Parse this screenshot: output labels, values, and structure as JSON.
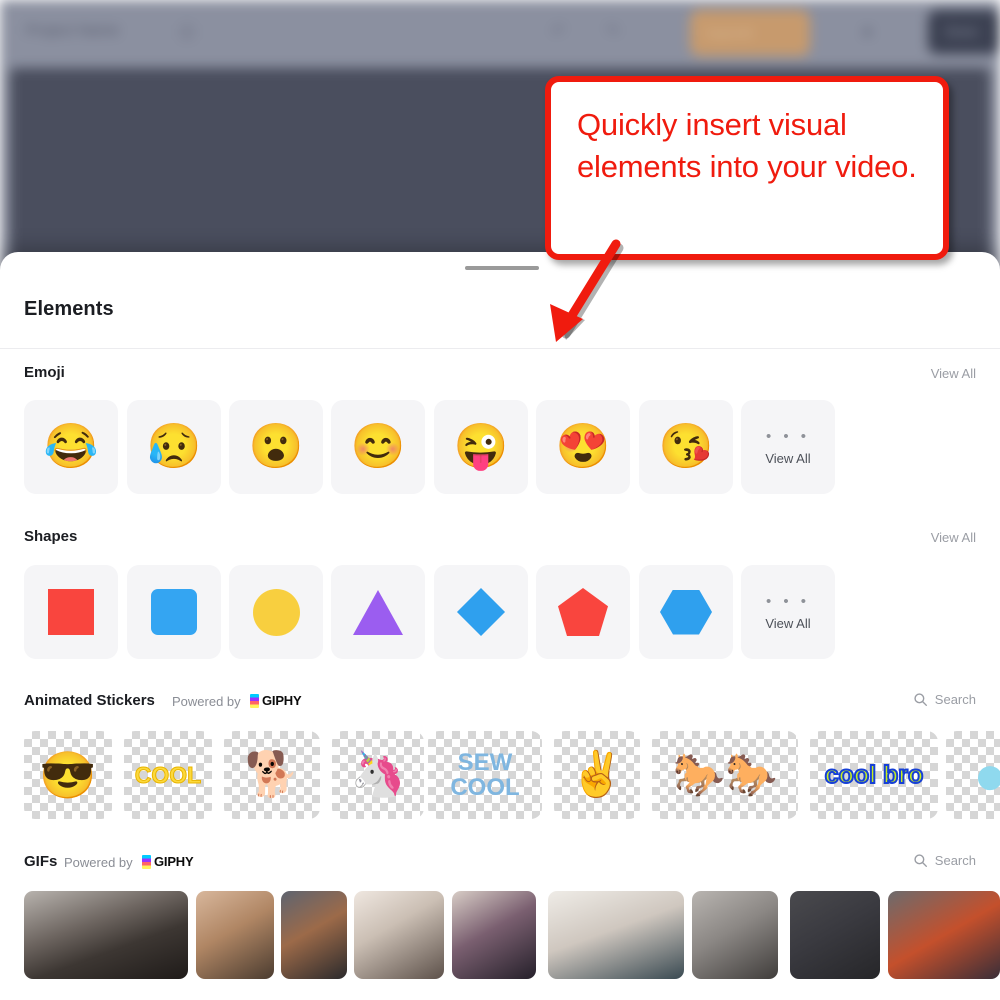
{
  "editor": {
    "project_title": "Project Name",
    "cta_label": "Upgrade",
    "export_label": "Done",
    "icons": [
      "folder-icon",
      "undo-icon",
      "redo-icon",
      "share-icon"
    ]
  },
  "callout": {
    "text": "Quickly insert visual elements into your video.",
    "border_color": "#f01b0e",
    "text_color": "#f01b0e",
    "arrow": "down-left-arrow"
  },
  "sheet": {
    "title": "Elements",
    "drag_handle": "sheet-drag-handle"
  },
  "sections": {
    "emoji": {
      "title": "Emoji",
      "view_all": "View All",
      "items": [
        {
          "name": "face-with-tears-of-joy",
          "glyph": "😂"
        },
        {
          "name": "sad-but-relieved-face",
          "glyph": "😥"
        },
        {
          "name": "face-with-open-mouth",
          "glyph": "😮"
        },
        {
          "name": "smiling-face-with-smiling-eyes",
          "glyph": "😊"
        },
        {
          "name": "winking-face-with-tongue",
          "glyph": "😜"
        },
        {
          "name": "smiling-face-with-heart-eyes",
          "glyph": "😍"
        },
        {
          "name": "face-blowing-a-kiss",
          "glyph": "😘"
        }
      ],
      "more_tile": {
        "dots": "• • •",
        "label": "View All"
      }
    },
    "shapes": {
      "title": "Shapes",
      "view_all": "View All",
      "items": [
        {
          "name": "square-shape",
          "kind": "sq-sharp",
          "color": "#f9453e"
        },
        {
          "name": "rounded-square-shape",
          "kind": "sq-round",
          "color": "#34a5f2"
        },
        {
          "name": "circle-shape",
          "kind": "circle",
          "color": "#f8cf3f"
        },
        {
          "name": "triangle-shape",
          "kind": "tri",
          "color": "#9b5df0"
        },
        {
          "name": "diamond-shape",
          "kind": "diamond",
          "color": "#2fa0ee"
        },
        {
          "name": "pentagon-shape",
          "kind": "pentagon",
          "color": "#f9453e"
        },
        {
          "name": "hexagon-shape",
          "kind": "hexagon",
          "color": "#2fa0ee"
        }
      ],
      "more_tile": {
        "dots": "• • •",
        "label": "View All"
      }
    },
    "animated_stickers": {
      "title": "Animated Stickers",
      "powered_by": "Powered by",
      "brand": "GIPHY",
      "search": "Search",
      "items": [
        {
          "name": "sticker-cool-sunglasses-emoji",
          "text": "😎"
        },
        {
          "name": "sticker-cool-text",
          "text": "COOL"
        },
        {
          "name": "sticker-dog-sunglasses",
          "text": "🐕"
        },
        {
          "name": "sticker-unicorn-cool-banner",
          "text": "🦄"
        },
        {
          "name": "sticker-sew-cool-text",
          "text": "SEW COOL"
        },
        {
          "name": "sticker-peace-hand",
          "text": "✌"
        },
        {
          "name": "sticker-ponies-sunglasses",
          "text": "🐎🐎"
        },
        {
          "name": "sticker-cool-bro-text",
          "text": "cool bro"
        },
        {
          "name": "sticker-cyan-circle",
          "text": "●"
        }
      ]
    },
    "gifs": {
      "title": "GIFs",
      "powered_by": "Powered by",
      "brand": "GIPHY",
      "search": "Search",
      "items": [
        {
          "name": "gif-man-turning-head"
        },
        {
          "name": "gif-man-eyes-closed"
        },
        {
          "name": "gif-puppet-monkey"
        },
        {
          "name": "gif-man-in-room"
        },
        {
          "name": "gif-girl-purple-light"
        },
        {
          "name": "gif-white-cat"
        },
        {
          "name": "gif-person-on-street"
        },
        {
          "name": "gif-lightsaber-fight"
        },
        {
          "name": "gif-spiderman-cartoon"
        }
      ]
    }
  }
}
